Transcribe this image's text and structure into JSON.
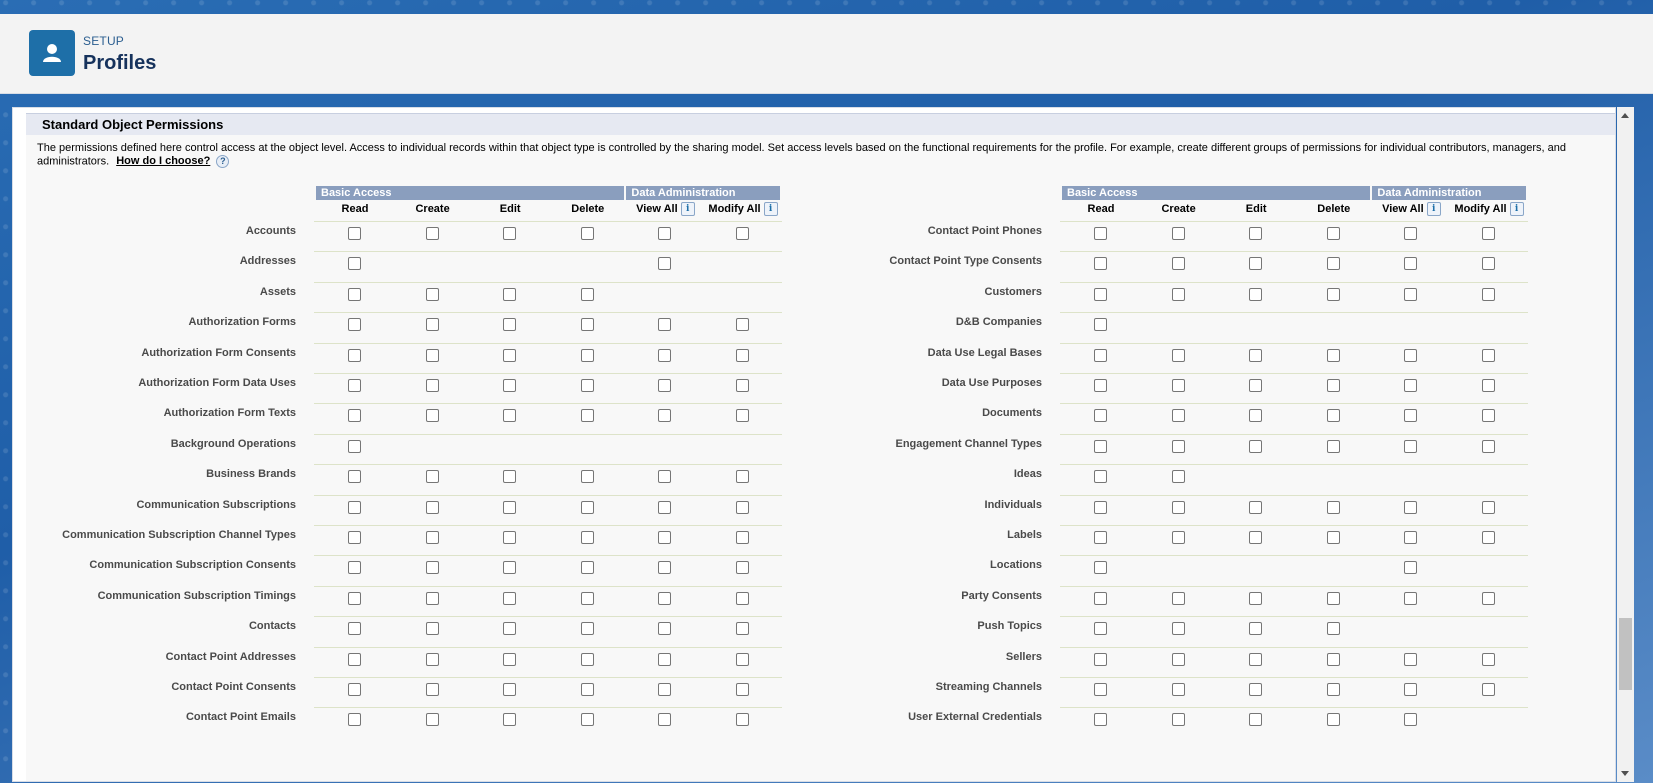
{
  "header": {
    "setup_label": "SETUP",
    "title": "Profiles",
    "icon": "user-icon"
  },
  "section": {
    "title": "Standard Object Permissions",
    "description": "The permissions defined here control access at the object level. Access to individual records within that object type is controlled by the sharing model. Set access levels based on the functional requirements for the profile. For example, create different groups of permissions for individual contributors, managers, and administrators.",
    "help_link": "How do I choose?",
    "help_icon": "?"
  },
  "groups": {
    "basic_access": "Basic Access",
    "data_admin": "Data Administration"
  },
  "columns": [
    "Read",
    "Create",
    "Edit",
    "Delete",
    "View All",
    "Modify All"
  ],
  "info_icon": "i",
  "left_objects": [
    {
      "name": "Accounts",
      "perms": [
        1,
        1,
        1,
        1,
        1,
        1
      ]
    },
    {
      "name": "Addresses",
      "perms": [
        1,
        0,
        0,
        0,
        1,
        0
      ]
    },
    {
      "name": "Assets",
      "perms": [
        1,
        1,
        1,
        1,
        0,
        0
      ]
    },
    {
      "name": "Authorization Forms",
      "perms": [
        1,
        1,
        1,
        1,
        1,
        1
      ]
    },
    {
      "name": "Authorization Form Consents",
      "perms": [
        1,
        1,
        1,
        1,
        1,
        1
      ]
    },
    {
      "name": "Authorization Form Data Uses",
      "perms": [
        1,
        1,
        1,
        1,
        1,
        1
      ]
    },
    {
      "name": "Authorization Form Texts",
      "perms": [
        1,
        1,
        1,
        1,
        1,
        1
      ]
    },
    {
      "name": "Background Operations",
      "perms": [
        1,
        0,
        0,
        0,
        0,
        0
      ]
    },
    {
      "name": "Business Brands",
      "perms": [
        1,
        1,
        1,
        1,
        1,
        1
      ]
    },
    {
      "name": "Communication Subscriptions",
      "perms": [
        1,
        1,
        1,
        1,
        1,
        1
      ]
    },
    {
      "name": "Communication Subscription Channel Types",
      "perms": [
        1,
        1,
        1,
        1,
        1,
        1
      ]
    },
    {
      "name": "Communication Subscription Consents",
      "perms": [
        1,
        1,
        1,
        1,
        1,
        1
      ]
    },
    {
      "name": "Communication Subscription Timings",
      "perms": [
        1,
        1,
        1,
        1,
        1,
        1
      ]
    },
    {
      "name": "Contacts",
      "perms": [
        1,
        1,
        1,
        1,
        1,
        1
      ]
    },
    {
      "name": "Contact Point Addresses",
      "perms": [
        1,
        1,
        1,
        1,
        1,
        1
      ]
    },
    {
      "name": "Contact Point Consents",
      "perms": [
        1,
        1,
        1,
        1,
        1,
        1
      ]
    },
    {
      "name": "Contact Point Emails",
      "perms": [
        1,
        1,
        1,
        1,
        1,
        1
      ]
    }
  ],
  "right_objects": [
    {
      "name": "Contact Point Phones",
      "perms": [
        1,
        1,
        1,
        1,
        1,
        1
      ]
    },
    {
      "name": "Contact Point Type Consents",
      "perms": [
        1,
        1,
        1,
        1,
        1,
        1
      ]
    },
    {
      "name": "Customers",
      "perms": [
        1,
        1,
        1,
        1,
        1,
        1
      ]
    },
    {
      "name": "D&B Companies",
      "perms": [
        1,
        0,
        0,
        0,
        0,
        0
      ]
    },
    {
      "name": "Data Use Legal Bases",
      "perms": [
        1,
        1,
        1,
        1,
        1,
        1
      ]
    },
    {
      "name": "Data Use Purposes",
      "perms": [
        1,
        1,
        1,
        1,
        1,
        1
      ]
    },
    {
      "name": "Documents",
      "perms": [
        1,
        1,
        1,
        1,
        1,
        1
      ]
    },
    {
      "name": "Engagement Channel Types",
      "perms": [
        1,
        1,
        1,
        1,
        1,
        1
      ]
    },
    {
      "name": "Ideas",
      "perms": [
        1,
        1,
        0,
        0,
        0,
        0
      ]
    },
    {
      "name": "Individuals",
      "perms": [
        1,
        1,
        1,
        1,
        1,
        1
      ]
    },
    {
      "name": "Labels",
      "perms": [
        1,
        1,
        1,
        1,
        1,
        1
      ]
    },
    {
      "name": "Locations",
      "perms": [
        1,
        0,
        0,
        0,
        1,
        0
      ]
    },
    {
      "name": "Party Consents",
      "perms": [
        1,
        1,
        1,
        1,
        1,
        1
      ]
    },
    {
      "name": "Push Topics",
      "perms": [
        1,
        1,
        1,
        1,
        0,
        0
      ]
    },
    {
      "name": "Sellers",
      "perms": [
        1,
        1,
        1,
        1,
        1,
        1
      ]
    },
    {
      "name": "Streaming Channels",
      "perms": [
        1,
        1,
        1,
        1,
        1,
        1
      ]
    },
    {
      "name": "User External Credentials",
      "perms": [
        1,
        1,
        1,
        1,
        1,
        0
      ]
    }
  ]
}
